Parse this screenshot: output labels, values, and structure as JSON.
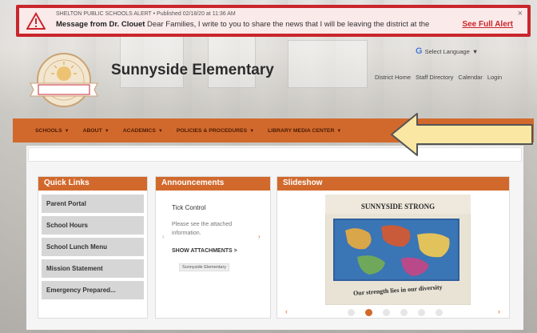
{
  "alert": {
    "meta": "SHELTON PUBLIC SCHOOLS ALERT • Published 02/18/20 at 11:36 AM",
    "title": "Message from Dr. Clouet",
    "message": "Dear Families,  I write to you to share the news that I will be leaving the district at the e...",
    "link": "See Full Alert",
    "close": "×"
  },
  "header": {
    "school_name": "Sunnyside Elementary",
    "select_language": "Select Language",
    "top_links": [
      "District Home",
      "Staff Directory",
      "Calendar",
      "Login"
    ]
  },
  "nav": {
    "items": [
      "SCHOOLS",
      "ABOUT",
      "ACADEMICS",
      "POLICIES & PROCEDURES",
      "LIBRARY MEDIA CENTER"
    ]
  },
  "quick_links": {
    "title": "Quick Links",
    "items": [
      "Parent Portal",
      "School Hours",
      "School Lunch Menu",
      "Mission Statement",
      "Emergency Prepared..."
    ]
  },
  "announcements": {
    "title": "Announcements",
    "item_title": "Tick Control",
    "item_body": "Please see the attached information.",
    "show_attachments": "SHOW ATTACHMENTS >",
    "tag": "Sunnyside Elementary"
  },
  "slideshow": {
    "title": "Slideshow",
    "image_text_top": "SUNNYSIDE STRONG",
    "image_text_bottom": "Our strength lies in our diversity",
    "dots": 6,
    "active_dot": 2
  },
  "colors": {
    "accent": "#d2692c",
    "alert_red": "#c9262c",
    "arrow_fill": "#fbe7a4"
  }
}
